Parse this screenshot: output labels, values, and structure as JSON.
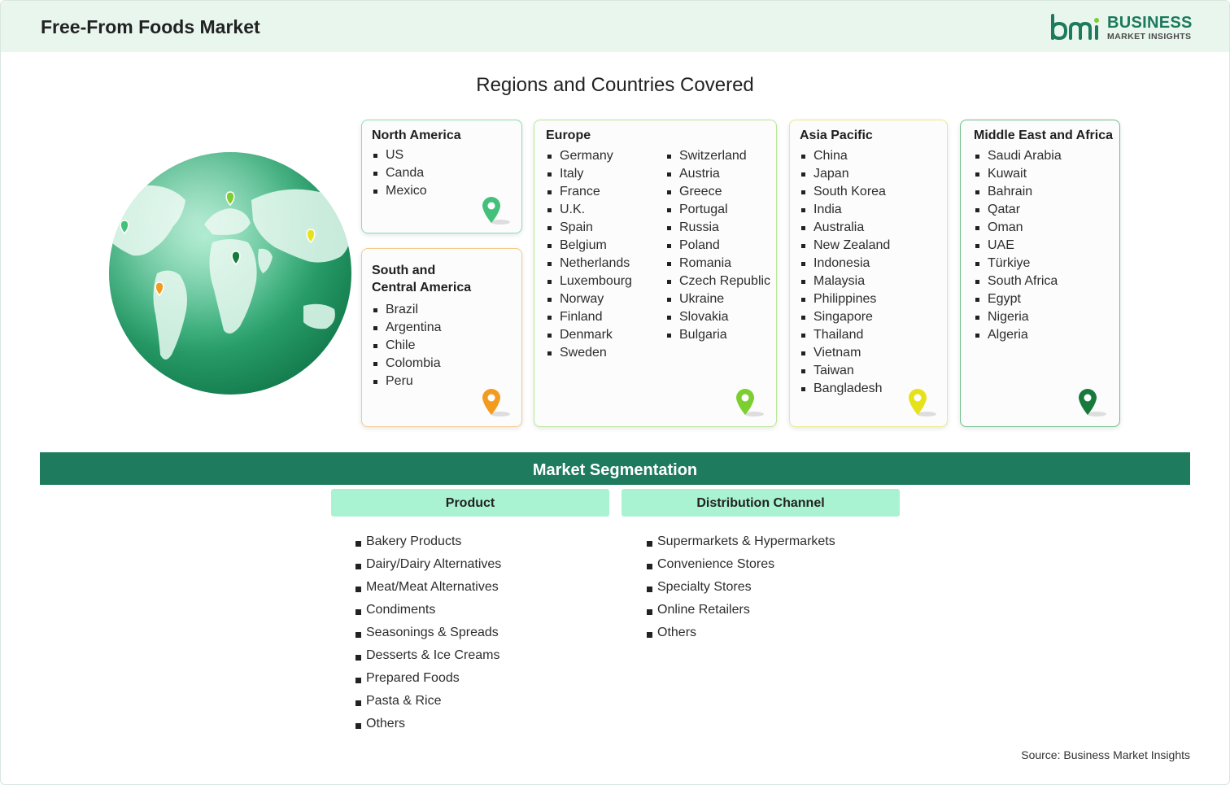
{
  "header": {
    "title": "Free-From Foods Market",
    "logo": {
      "mark": "bmi",
      "word1": "BUSINESS",
      "word2": "MARKET INSIGHTS",
      "color": "#1d7a5c"
    }
  },
  "regions_section": {
    "title": "Regions and Countries Covered",
    "regions": {
      "north_america": {
        "title": "North America",
        "countries": [
          "US",
          "Canda",
          "Mexico"
        ],
        "pin_color": "#43c07a"
      },
      "south_america": {
        "title_line1": "South and",
        "title_line2": "Central America",
        "countries": [
          "Brazil",
          "Argentina",
          "Chile",
          "Colombia",
          "Peru"
        ],
        "pin_color": "#f29b1f"
      },
      "europe": {
        "title": "Europe",
        "countries_col1": [
          "Germany",
          "Italy",
          "France",
          "U.K.",
          "Spain",
          "Belgium",
          "Netherlands",
          "Luxembourg",
          "Norway",
          "Finland",
          "Denmark",
          "Sweden"
        ],
        "countries_col2": [
          "Switzerland",
          "Austria",
          "Greece",
          "Portugal",
          "Russia",
          "Poland",
          "Romania",
          "Czech Republic",
          "Ukraine",
          "Slovakia",
          "Bulgaria"
        ],
        "pin_color": "#7ccf2f"
      },
      "asia_pacific": {
        "title": "Asia Pacific",
        "countries": [
          "China",
          "Japan",
          "South Korea",
          "India",
          "Australia",
          "New Zealand",
          "Indonesia",
          "Malaysia",
          "Philippines",
          "Singapore",
          "Thailand",
          "Vietnam",
          "Taiwan",
          "Bangladesh"
        ],
        "pin_color": "#e6e21a"
      },
      "mea": {
        "title": "Middle East and Africa",
        "countries": [
          "Saudi Arabia",
          "Kuwait",
          "Bahrain",
          "Qatar",
          "Oman",
          "UAE",
          "Türkiye",
          "South Africa",
          "Egypt",
          "Nigeria",
          "Algeria"
        ],
        "pin_color": "#177a3c"
      }
    }
  },
  "segmentation": {
    "title": "Market Segmentation",
    "product": {
      "heading": "Product",
      "items": [
        "Bakery Products",
        "Dairy/Dairy Alternatives",
        "Meat/Meat Alternatives",
        "Condiments",
        "Seasonings & Spreads",
        "Desserts & Ice Creams",
        "Prepared Foods",
        "Pasta & Rice",
        "Others"
      ]
    },
    "distribution": {
      "heading": "Distribution Channel",
      "items": [
        "Supermarkets & Hypermarkets",
        "Convenience Stores",
        "Specialty Stores",
        "Online Retailers",
        "Others"
      ]
    }
  },
  "source": "Source: Business Market Insights",
  "colors": {
    "header_bg": "#e8f6ee",
    "segment_bar": "#1e7b5d",
    "segment_head": "#a9f3d2"
  }
}
